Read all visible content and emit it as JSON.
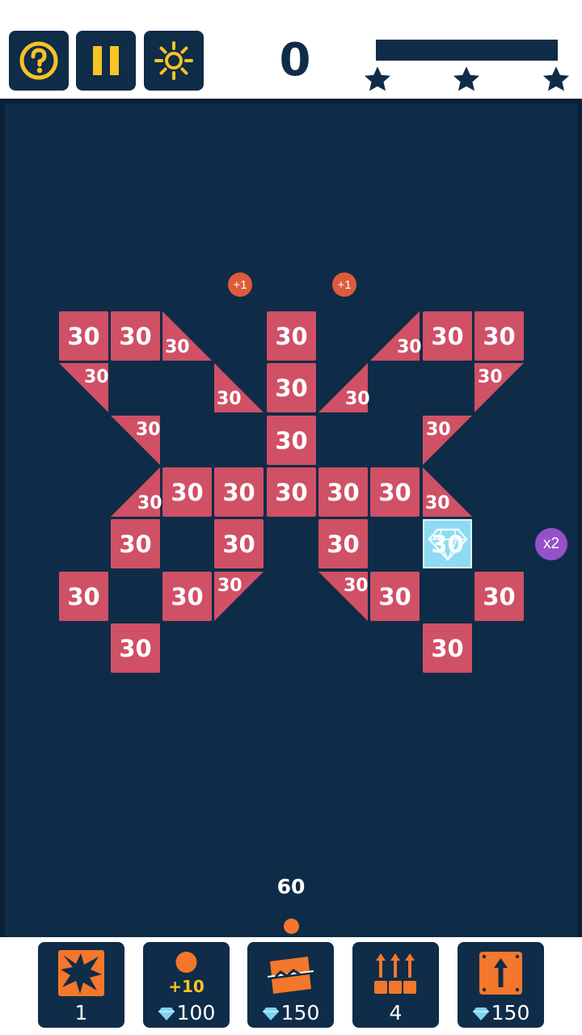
{
  "colors": {
    "navy": "#0f2c48",
    "field": "#0e2c47",
    "block": "#d05065",
    "accent_yellow": "#f7c325",
    "orange": "#f4772b",
    "gem_blue": "#8fdaf2",
    "purple": "#9651c8"
  },
  "top": {
    "help_icon": "question-mark-icon",
    "pause_icon": "pause-icon",
    "brightness_icon": "sun-icon",
    "score": "0",
    "stars_earned": 0,
    "stars_total": 3
  },
  "board": {
    "block_value": "30",
    "plus_pickup": "+1",
    "multiplier_pickup": "x2",
    "ball_count": "60"
  },
  "powerups": [
    {
      "name": "bomb",
      "icon": "explosion-icon",
      "label": "1"
    },
    {
      "name": "extra-balls",
      "icon": "plus-ten-ball-icon",
      "icon_text": "+10",
      "label": "100",
      "currency_icon": "diamond-icon"
    },
    {
      "name": "laser",
      "icon": "laser-cut-icon",
      "label": "150",
      "currency_icon": "diamond-icon"
    },
    {
      "name": "push-row-up",
      "icon": "row-up-arrows-icon",
      "label": "4"
    },
    {
      "name": "lift-block",
      "icon": "box-up-arrow-icon",
      "label": "150",
      "currency_icon": "diamond-icon"
    }
  ]
}
